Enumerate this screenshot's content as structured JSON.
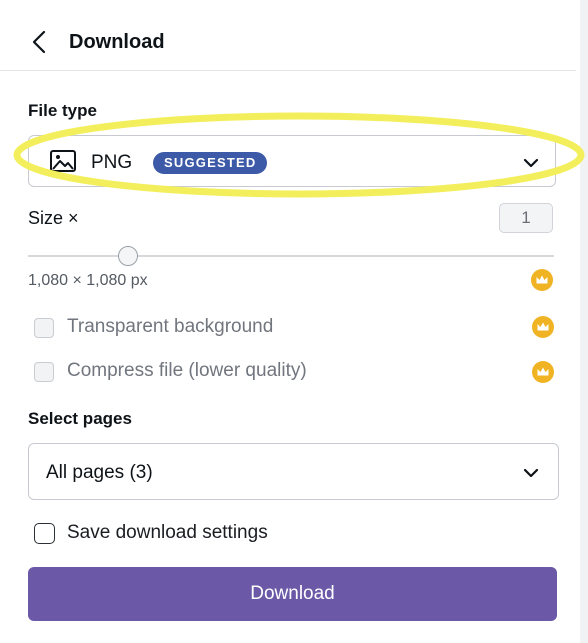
{
  "header": {
    "title": "Download",
    "back_icon": "chevron-left-icon"
  },
  "file_type": {
    "label": "File type",
    "value": "PNG",
    "badge": "SUGGESTED",
    "icon": "image-icon",
    "badge_color": "#3d5aa8",
    "highlight_color": "#f3ef5c"
  },
  "size": {
    "label": "Size ×",
    "value": "1",
    "dimensions": "1,080 × 1,080 px",
    "crown_icon": "crown-icon",
    "crown_color": "#f0b323"
  },
  "options": [
    {
      "label": "Transparent background",
      "checked": false,
      "premium": true
    },
    {
      "label": "Compress file (lower quality)",
      "checked": false,
      "premium": true
    }
  ],
  "pages": {
    "label": "Select pages",
    "value": "All pages (3)"
  },
  "save_settings": {
    "label": "Save download settings",
    "checked": false
  },
  "download_button": {
    "label": "Download",
    "color": "#6b59a7"
  }
}
